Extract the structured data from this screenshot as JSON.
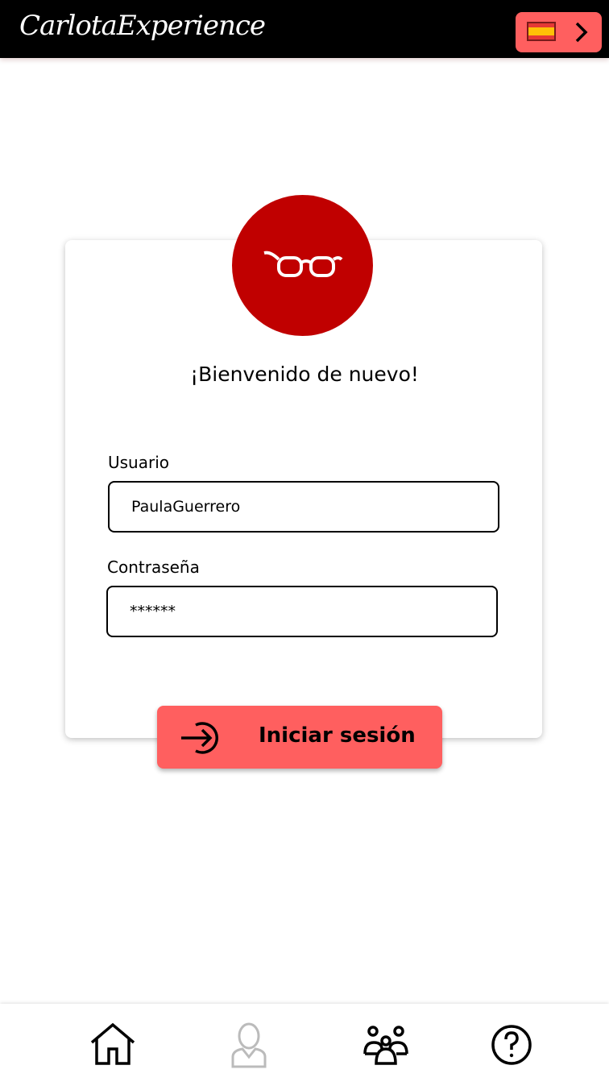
{
  "header": {
    "logo": "CarlotaExperience",
    "language_button_icon": "spain-flag-icon"
  },
  "login": {
    "welcome": "¡Bienvenido de nuevo!",
    "username_label": "Usuario",
    "username_value": "PaulaGuerrero",
    "password_label": "Contraseña",
    "password_value": "******",
    "submit_label": "Iniciar sesión"
  },
  "colors": {
    "accent": "#ff5f5f",
    "avatar": "#c00000",
    "header": "#000000"
  },
  "bottom_nav": [
    {
      "icon": "home-icon"
    },
    {
      "icon": "user-icon",
      "state": "disabled"
    },
    {
      "icon": "group-icon"
    },
    {
      "icon": "help-icon"
    }
  ]
}
